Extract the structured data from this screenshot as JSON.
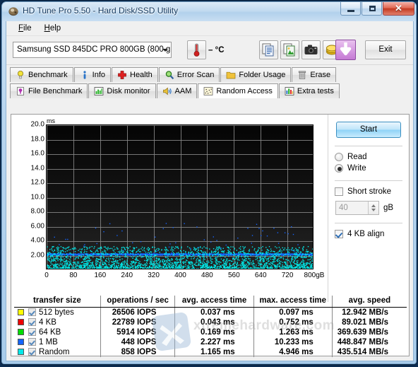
{
  "window": {
    "title": "HD Tune Pro 5.50 - Hard Disk/SSD Utility",
    "app_icon": "hdtune-logo-icon",
    "buttons": {
      "minimize": "minimize-icon",
      "maximize": "maximize-icon",
      "close": "close-icon"
    }
  },
  "menu": {
    "items": [
      {
        "label": "File",
        "accel": "F"
      },
      {
        "label": "Help",
        "accel": "H"
      }
    ]
  },
  "toolbar": {
    "drive": "Samsung SSD 845DC PRO 800GB (800 g",
    "temperature": "– °C",
    "thermometer_icon": "thermometer-icon",
    "buttons": [
      {
        "name": "copy-text-icon"
      },
      {
        "name": "copy-image-icon"
      },
      {
        "name": "screenshot-camera-icon"
      },
      {
        "name": "coins-icon"
      },
      {
        "name": "download-arrow-icon"
      }
    ],
    "exit_label": "Exit"
  },
  "tabs": {
    "row1": [
      {
        "label": "Benchmark",
        "icon": "lightbulb-icon",
        "active": false
      },
      {
        "label": "Info",
        "icon": "info-icon",
        "active": false
      },
      {
        "label": "Health",
        "icon": "red-cross-icon",
        "active": false
      },
      {
        "label": "Error Scan",
        "icon": "magnifier-icon",
        "active": false
      },
      {
        "label": "Folder Usage",
        "icon": "folder-icon",
        "active": false
      },
      {
        "label": "Erase",
        "icon": "trash-icon",
        "active": false
      }
    ],
    "row2": [
      {
        "label": "File Benchmark",
        "icon": "file-document-icon",
        "active": false
      },
      {
        "label": "Disk monitor",
        "icon": "bar-chart-icon",
        "active": false
      },
      {
        "label": "AAM",
        "icon": "speaker-icon",
        "active": false
      },
      {
        "label": "Random Access",
        "icon": "scatter-dots-icon",
        "active": true
      },
      {
        "label": "Extra tests",
        "icon": "chart-icon",
        "active": false
      }
    ]
  },
  "controls": {
    "start_label": "Start",
    "mode_options": [
      {
        "label": "Read",
        "selected": false
      },
      {
        "label": "Write",
        "selected": true
      }
    ],
    "short_stroke": {
      "label": "Short stroke",
      "checked": false
    },
    "short_stroke_value": "40",
    "short_stroke_unit": "gB",
    "align": {
      "label": "4 KB align",
      "checked": true
    }
  },
  "chart_data": {
    "type": "scatter",
    "title": "",
    "xlabel": "",
    "ylabel": "ms",
    "yunit": "ms",
    "xunit": "gB",
    "ylim": [
      0,
      20
    ],
    "xlim": [
      0,
      800
    ],
    "yticks": [
      "20.0",
      "18.0",
      "16.0",
      "14.0",
      "12.0",
      "10.0",
      "8.00",
      "6.00",
      "4.00",
      "2.00"
    ],
    "ytick_values": [
      20,
      18,
      16,
      14,
      12,
      10,
      8,
      6,
      4,
      2
    ],
    "xticks": [
      "0",
      "80",
      "160",
      "240",
      "320",
      "400",
      "480",
      "560",
      "640",
      "720",
      "800gB"
    ],
    "xtick_values": [
      0,
      80,
      160,
      240,
      320,
      400,
      480,
      560,
      640,
      720,
      800
    ],
    "grid": true,
    "legend_position": "table-below",
    "series": [
      {
        "name": "512 bytes",
        "color": "#ffff00",
        "mean_ms": 0.037,
        "max_ms": 0.097,
        "style": "band"
      },
      {
        "name": "4 KB",
        "color": "#ee0000",
        "mean_ms": 0.043,
        "max_ms": 0.752,
        "style": "band"
      },
      {
        "name": "64 KB",
        "color": "#00dd00",
        "mean_ms": 0.169,
        "max_ms": 1.263,
        "style": "band"
      },
      {
        "name": "1 MB",
        "color": "#1464ff",
        "mean_ms": 2.227,
        "max_ms": 10.233,
        "style": "band"
      },
      {
        "name": "Random",
        "color": "#00e8e8",
        "mean_ms": 1.165,
        "max_ms": 4.946,
        "style": "scatter"
      }
    ]
  },
  "results": {
    "headers": [
      "transfer size",
      "operations / sec",
      "avg. access time",
      "max. access time",
      "avg. speed"
    ],
    "rows": [
      {
        "color": "#ffff00",
        "size": "512 bytes",
        "iops": "26506 IOPS",
        "avg_access": "0.037 ms",
        "max_access": "0.097 ms",
        "avg_speed": "12.942 MB/s",
        "checked": true
      },
      {
        "color": "#ee0000",
        "size": "4 KB",
        "iops": "22789 IOPS",
        "avg_access": "0.043 ms",
        "max_access": "0.752 ms",
        "avg_speed": "89.021 MB/s",
        "checked": true
      },
      {
        "color": "#00dd00",
        "size": "64 KB",
        "iops": "5914 IOPS",
        "avg_access": "0.169 ms",
        "max_access": "1.263 ms",
        "avg_speed": "369.639 MB/s",
        "checked": true
      },
      {
        "color": "#1464ff",
        "size": "1 MB",
        "iops": "448 IOPS",
        "avg_access": "2.227 ms",
        "max_access": "10.233 ms",
        "avg_speed": "448.847 MB/s",
        "checked": true
      },
      {
        "color": "#00e8e8",
        "size": "Random",
        "iops": "858 IOPS",
        "avg_access": "1.165 ms",
        "max_access": "4.946 ms",
        "avg_speed": "435.514 MB/s",
        "checked": true
      }
    ]
  },
  "watermark": {
    "text": "xtremehardware.com"
  }
}
